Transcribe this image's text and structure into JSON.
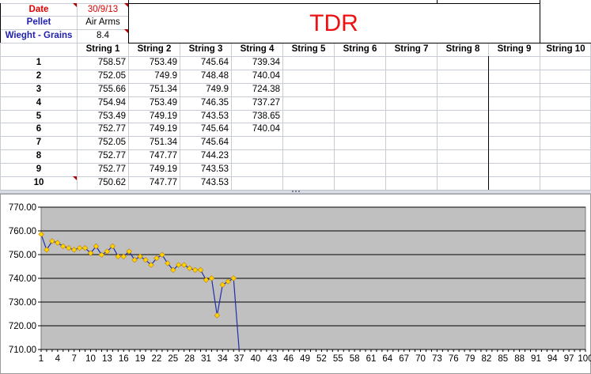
{
  "sheet": {
    "title": "TDR",
    "info": [
      {
        "label": "Date",
        "value": "30/9/13"
      },
      {
        "label": "Pellet",
        "value": "Air Arms"
      },
      {
        "label": "Wieght - Grains",
        "value": "8.4"
      }
    ],
    "column_headers": [
      "String 1",
      "String 2",
      "String 3",
      "String 4",
      "String 5",
      "String 6",
      "String 7",
      "String 8",
      "String 9",
      "String 10"
    ],
    "rows": [
      {
        "shot": "1",
        "values": [
          "758.57",
          "753.49",
          "745.64",
          "739.34",
          "",
          "",
          "",
          "",
          "",
          ""
        ]
      },
      {
        "shot": "2",
        "values": [
          "752.05",
          "749.9",
          "748.48",
          "740.04",
          "",
          "",
          "",
          "",
          "",
          ""
        ]
      },
      {
        "shot": "3",
        "values": [
          "755.66",
          "751.34",
          "749.9",
          "724.38",
          "",
          "",
          "",
          "",
          "",
          ""
        ]
      },
      {
        "shot": "4",
        "values": [
          "754.94",
          "753.49",
          "746.35",
          "737.27",
          "",
          "",
          "",
          "",
          "",
          ""
        ]
      },
      {
        "shot": "5",
        "values": [
          "753.49",
          "749.19",
          "743.53",
          "738.65",
          "",
          "",
          "",
          "",
          "",
          ""
        ]
      },
      {
        "shot": "6",
        "values": [
          "752.77",
          "749.19",
          "745.64",
          "740.04",
          "",
          "",
          "",
          "",
          "",
          ""
        ]
      },
      {
        "shot": "7",
        "values": [
          "752.05",
          "751.34",
          "745.64",
          "",
          "",
          "",
          "",
          "",
          "",
          ""
        ]
      },
      {
        "shot": "8",
        "values": [
          "752.77",
          "747.77",
          "744.23",
          "",
          "",
          "",
          "",
          "",
          "",
          ""
        ]
      },
      {
        "shot": "9",
        "values": [
          "752.77",
          "749.19",
          "743.53",
          "",
          "",
          "",
          "",
          "",
          "",
          ""
        ]
      },
      {
        "shot": "10",
        "values": [
          "750.62",
          "747.77",
          "743.53",
          "",
          "",
          "",
          "",
          "",
          "",
          ""
        ]
      }
    ],
    "colors": {
      "red_text": "#e00000",
      "blue_text": "#1f1fb0",
      "title": "#ee1111",
      "grid": "#c8ccd4"
    }
  },
  "chart_data": {
    "type": "line",
    "title": "",
    "xlabel": "",
    "ylabel": "",
    "ylim": [
      710,
      770
    ],
    "xlim": [
      1,
      100
    ],
    "yticks": [
      "770.00",
      "760.00",
      "750.00",
      "740.00",
      "730.00",
      "720.00",
      "710.00"
    ],
    "xticks": [
      1,
      4,
      7,
      10,
      13,
      16,
      19,
      22,
      25,
      28,
      31,
      34,
      37,
      40,
      43,
      46,
      49,
      52,
      55,
      58,
      61,
      64,
      67,
      70,
      73,
      76,
      79,
      82,
      85,
      88,
      91,
      94,
      97,
      100
    ],
    "x": [
      1,
      2,
      3,
      4,
      5,
      6,
      7,
      8,
      9,
      10,
      11,
      12,
      13,
      14,
      15,
      16,
      17,
      18,
      19,
      20,
      21,
      22,
      23,
      24,
      25,
      26,
      27,
      28,
      29,
      30,
      31,
      32,
      33,
      34,
      35,
      36,
      37
    ],
    "series": [
      {
        "values": [
          758.57,
          752.05,
          755.66,
          754.94,
          753.49,
          752.77,
          752.05,
          752.77,
          752.77,
          750.62,
          753.49,
          749.9,
          751.34,
          753.49,
          749.19,
          749.19,
          751.34,
          747.77,
          749.19,
          747.77,
          745.64,
          748.48,
          749.9,
          746.35,
          743.53,
          745.64,
          745.64,
          744.23,
          743.53,
          743.53,
          739.34,
          740.04,
          724.38,
          737.27,
          738.65,
          740.04,
          710.0
        ],
        "line_color": "#1f2fa8",
        "marker_color": "#ffd400"
      }
    ],
    "plot_background": "#c0c0c0",
    "grid": true,
    "legend": "none"
  }
}
